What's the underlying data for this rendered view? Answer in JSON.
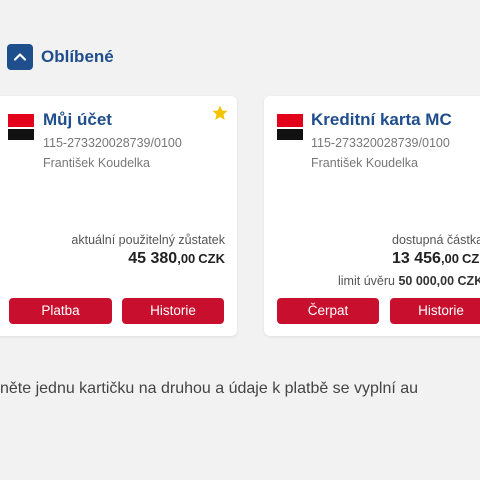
{
  "section": {
    "title": "Oblíbené",
    "collapse_icon": "chevron-up-icon"
  },
  "colors": {
    "brand_blue": "#1f4e8c",
    "action_red": "#c8102e",
    "star": "#f5c400"
  },
  "cards": [
    {
      "title": "Můj účet",
      "account_number": "115-273320028739/0100",
      "owner": "František Koudelka",
      "favorite": true,
      "balance_label": "aktuální použitelný zůstatek",
      "balance_int": "45 380",
      "balance_dec": ",00",
      "currency": "CZK",
      "button_primary": "Platba",
      "button_secondary": "Historie"
    },
    {
      "title": "Kreditní karta MC",
      "account_number": "115-273320028739/0100",
      "owner": "František Koudelka",
      "balance_label": "dostupná částka",
      "balance_int": "13 456",
      "balance_dec": ",00",
      "currency": "CZK",
      "limit_label": "limit úvěru",
      "limit_value": "50 000,00 CZK",
      "button_primary": "Čerpat",
      "button_secondary": "Historie"
    }
  ],
  "hint": "něte jednu kartičku na druhou a údaje k platbě se vyplní au"
}
